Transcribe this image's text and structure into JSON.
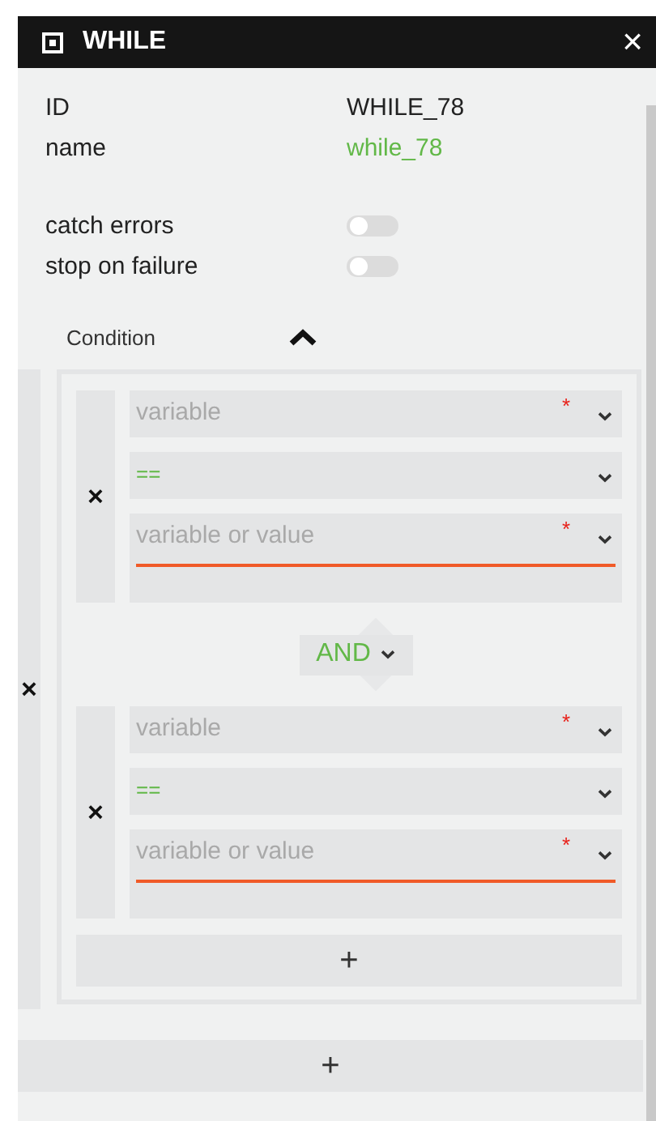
{
  "window": {
    "title": "WHILE",
    "close": "×"
  },
  "properties": [
    {
      "label": "ID",
      "value": "WHILE_78",
      "kind": "text"
    },
    {
      "label": "name",
      "value": "while_78",
      "kind": "link"
    }
  ],
  "toggles": [
    {
      "label": "catch errors",
      "on": false
    },
    {
      "label": "stop on failure",
      "on": false
    }
  ],
  "condition": {
    "label": "Condition",
    "expanded": true,
    "remove": "×",
    "add": "+",
    "rows": [
      {
        "kind": "rule",
        "remove": "×",
        "fields": [
          {
            "kind": "input",
            "placeholder": "variable",
            "mark": "*",
            "invalid": false
          },
          {
            "kind": "value",
            "value": "=="
          },
          {
            "kind": "input",
            "placeholder": "variable or value",
            "mark": "*",
            "invalid": true
          }
        ]
      },
      {
        "kind": "operator",
        "value": "AND"
      },
      {
        "kind": "rule",
        "remove": "×",
        "fields": [
          {
            "kind": "input",
            "placeholder": "variable",
            "mark": "*",
            "invalid": false
          },
          {
            "kind": "value",
            "value": "=="
          },
          {
            "kind": "input",
            "placeholder": "variable or value",
            "mark": "*",
            "invalid": true
          }
        ]
      }
    ]
  },
  "add_group": "+"
}
